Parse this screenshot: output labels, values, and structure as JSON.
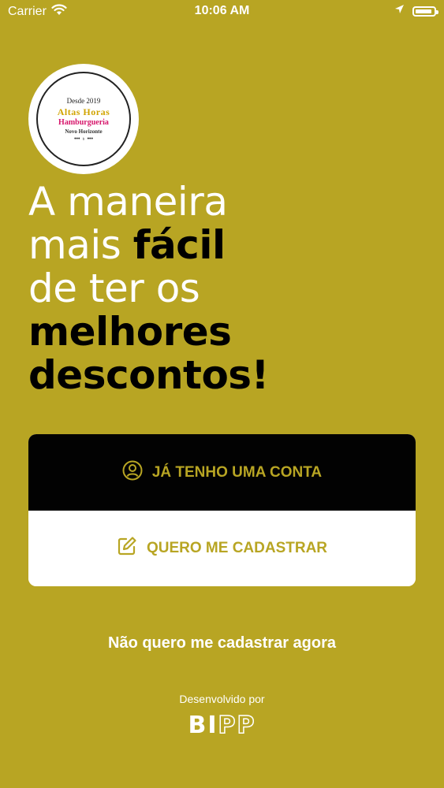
{
  "status_bar": {
    "carrier": "Carrier",
    "time": "10:06 AM",
    "battery_level": 0.9,
    "icons": [
      "wifi-icon",
      "location-arrow-icon",
      "battery-icon"
    ]
  },
  "logo": {
    "since_label": "Desde 2019",
    "name": "Altas Horas",
    "subtitle": "Hamburgueria",
    "city": "Novo Horizonte"
  },
  "headline": {
    "line1": "A maneira",
    "line2_regular": "mais ",
    "line2_bold": "fácil",
    "line3": "de ter os",
    "line4_bold": "melhores",
    "line5_bold": "descontos!"
  },
  "actions": {
    "login_label": "JÁ TENHO UMA CONTA",
    "login_icon": "user-circle-icon",
    "signup_label": "QUERO ME CADASTRAR",
    "signup_icon": "edit-icon",
    "skip_label": "Não quero me cadastrar agora"
  },
  "footer": {
    "developed_by": "Desenvolvido por",
    "brand_solid": "BI",
    "brand_outline": "PP"
  },
  "colors": {
    "background": "#b8a523",
    "accent": "#b8a523",
    "dark_button": "#020202",
    "light_button": "#ffffff"
  }
}
